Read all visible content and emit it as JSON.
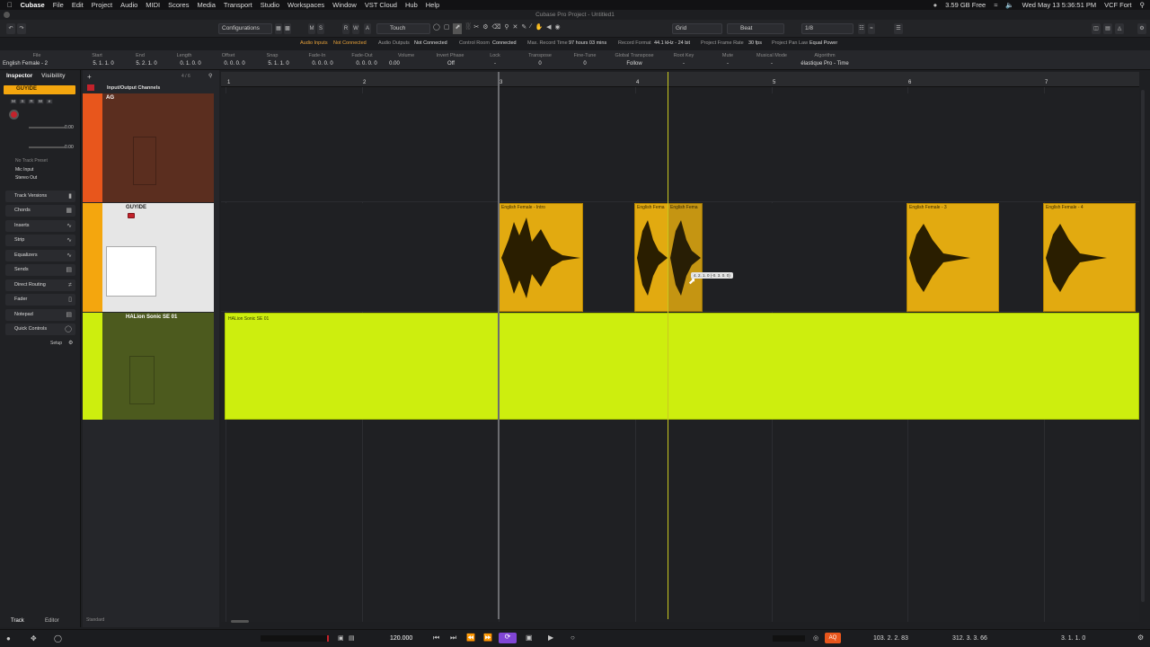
{
  "menubar": {
    "app": "Cubase",
    "items": [
      "File",
      "Edit",
      "Project",
      "Audio",
      "MIDI",
      "Scores",
      "Media",
      "Transport",
      "Studio",
      "Workspaces",
      "Window",
      "VST Cloud",
      "Hub",
      "Help"
    ],
    "memory": "3.59 GB Free",
    "clock": "Wed May 13  5:36:51 PM",
    "user": "VCF Fort"
  },
  "window_title": "Cubase Pro Project - Untitled1",
  "toolbar": {
    "configurations": "Configurations",
    "automation_mode": "Touch",
    "grid_type": "Grid",
    "snap_type": "Beat",
    "quantize": "1/8",
    "track_buttons": [
      "M",
      "S",
      "R",
      "W",
      "A"
    ]
  },
  "status": {
    "audio_inputs": "Audio Inputs",
    "not_connected": "Not Connected",
    "audio_outputs": "Audio Outputs",
    "not_connected_2": "Not Connected",
    "control_room": "Control Room",
    "connected": "Connected",
    "max_record_label": "Max. Record Time",
    "max_record_value": "97 hours 03 mins",
    "record_format_label": "Record Format",
    "record_format_value": "44.1 kHz - 24 bit",
    "frame_rate_label": "Project Frame Rate",
    "frame_rate_value": "30 fps",
    "pan_law_label": "Project Pan Law",
    "pan_law_value": "Equal Power"
  },
  "infoline": [
    {
      "label": "File",
      "value": "English Female - 2"
    },
    {
      "label": "Start",
      "value": "5. 1. 1.  0"
    },
    {
      "label": "End",
      "value": "5. 2. 1.  0"
    },
    {
      "label": "Length",
      "value": "0. 1. 0.  0"
    },
    {
      "label": "Offset",
      "value": "0. 0. 0.  0"
    },
    {
      "label": "Snap",
      "value": "5. 1. 1.  0"
    },
    {
      "label": "Fade-In",
      "value": "0. 0. 0.  0"
    },
    {
      "label": "Fade-Out",
      "value": "0. 0. 0.  0"
    },
    {
      "label": "Volume",
      "value": "0.00"
    },
    {
      "label": "Invert Phase",
      "value": "Off"
    },
    {
      "label": "Lock",
      "value": "-"
    },
    {
      "label": "Transpose",
      "value": "0"
    },
    {
      "label": "Fine-Tune",
      "value": "0"
    },
    {
      "label": "Global Transpose",
      "value": "Follow"
    },
    {
      "label": "Root Key",
      "value": "-"
    },
    {
      "label": "Mute",
      "value": "-"
    },
    {
      "label": "Musical Mode",
      "value": "-"
    },
    {
      "label": "Algorithm",
      "value": "élastique Pro - Time"
    }
  ],
  "inspector": {
    "tab_inspector": "Inspector",
    "tab_visibility": "Visibility",
    "track_name": "GUYIDE",
    "volume": "0.00",
    "pan": "0.00",
    "no_track_preset": "No Track Preset",
    "input": "Mic Input",
    "output": "Stereo Out",
    "sections": [
      "Track Versions",
      "Chords",
      "Inserts",
      "Strip",
      "Equalizers",
      "Sends",
      "Direct Routing",
      "Fader",
      "Notepad",
      "Quick Controls"
    ],
    "setup": "Setup",
    "bottom_tabs": [
      "Track",
      "Editor"
    ]
  },
  "tracklist": {
    "folder": "Input/Output Channels",
    "count": "4 / 6",
    "tracks": [
      {
        "name": "AG",
        "color": "#e8561c"
      },
      {
        "name": "GUYIDE",
        "color": "#f4a60e"
      },
      {
        "name": "HALion Sonic SE 01",
        "color": "#cdee0e"
      }
    ],
    "footer": "Standard"
  },
  "ruler": {
    "bars": [
      "1",
      "2",
      "3",
      "4",
      "5",
      "6",
      "7"
    ]
  },
  "clips": [
    {
      "name": "English Female - Intro",
      "color": "#e2aa10"
    },
    {
      "name": "English Fema",
      "color": "#e2aa10"
    },
    {
      "name": "English Fema",
      "color": "#e2aa10"
    },
    {
      "name": "English Female - 3",
      "color": "#e2aa10"
    },
    {
      "name": "English Female - 4",
      "color": "#e2aa10"
    }
  ],
  "instrument_clip": {
    "name": "HALion Sonic SE 01",
    "color": "#cdee0e"
  },
  "drag_tooltip": "4. 2. 1.  0 (-0. 3. 0.  0)",
  "transport": {
    "tempo": "120.000",
    "primary_time": "103.  2.  2.  83",
    "secondary_time": "312.  3.  3.  66",
    "right_time": "3.  1.  1.  0"
  }
}
